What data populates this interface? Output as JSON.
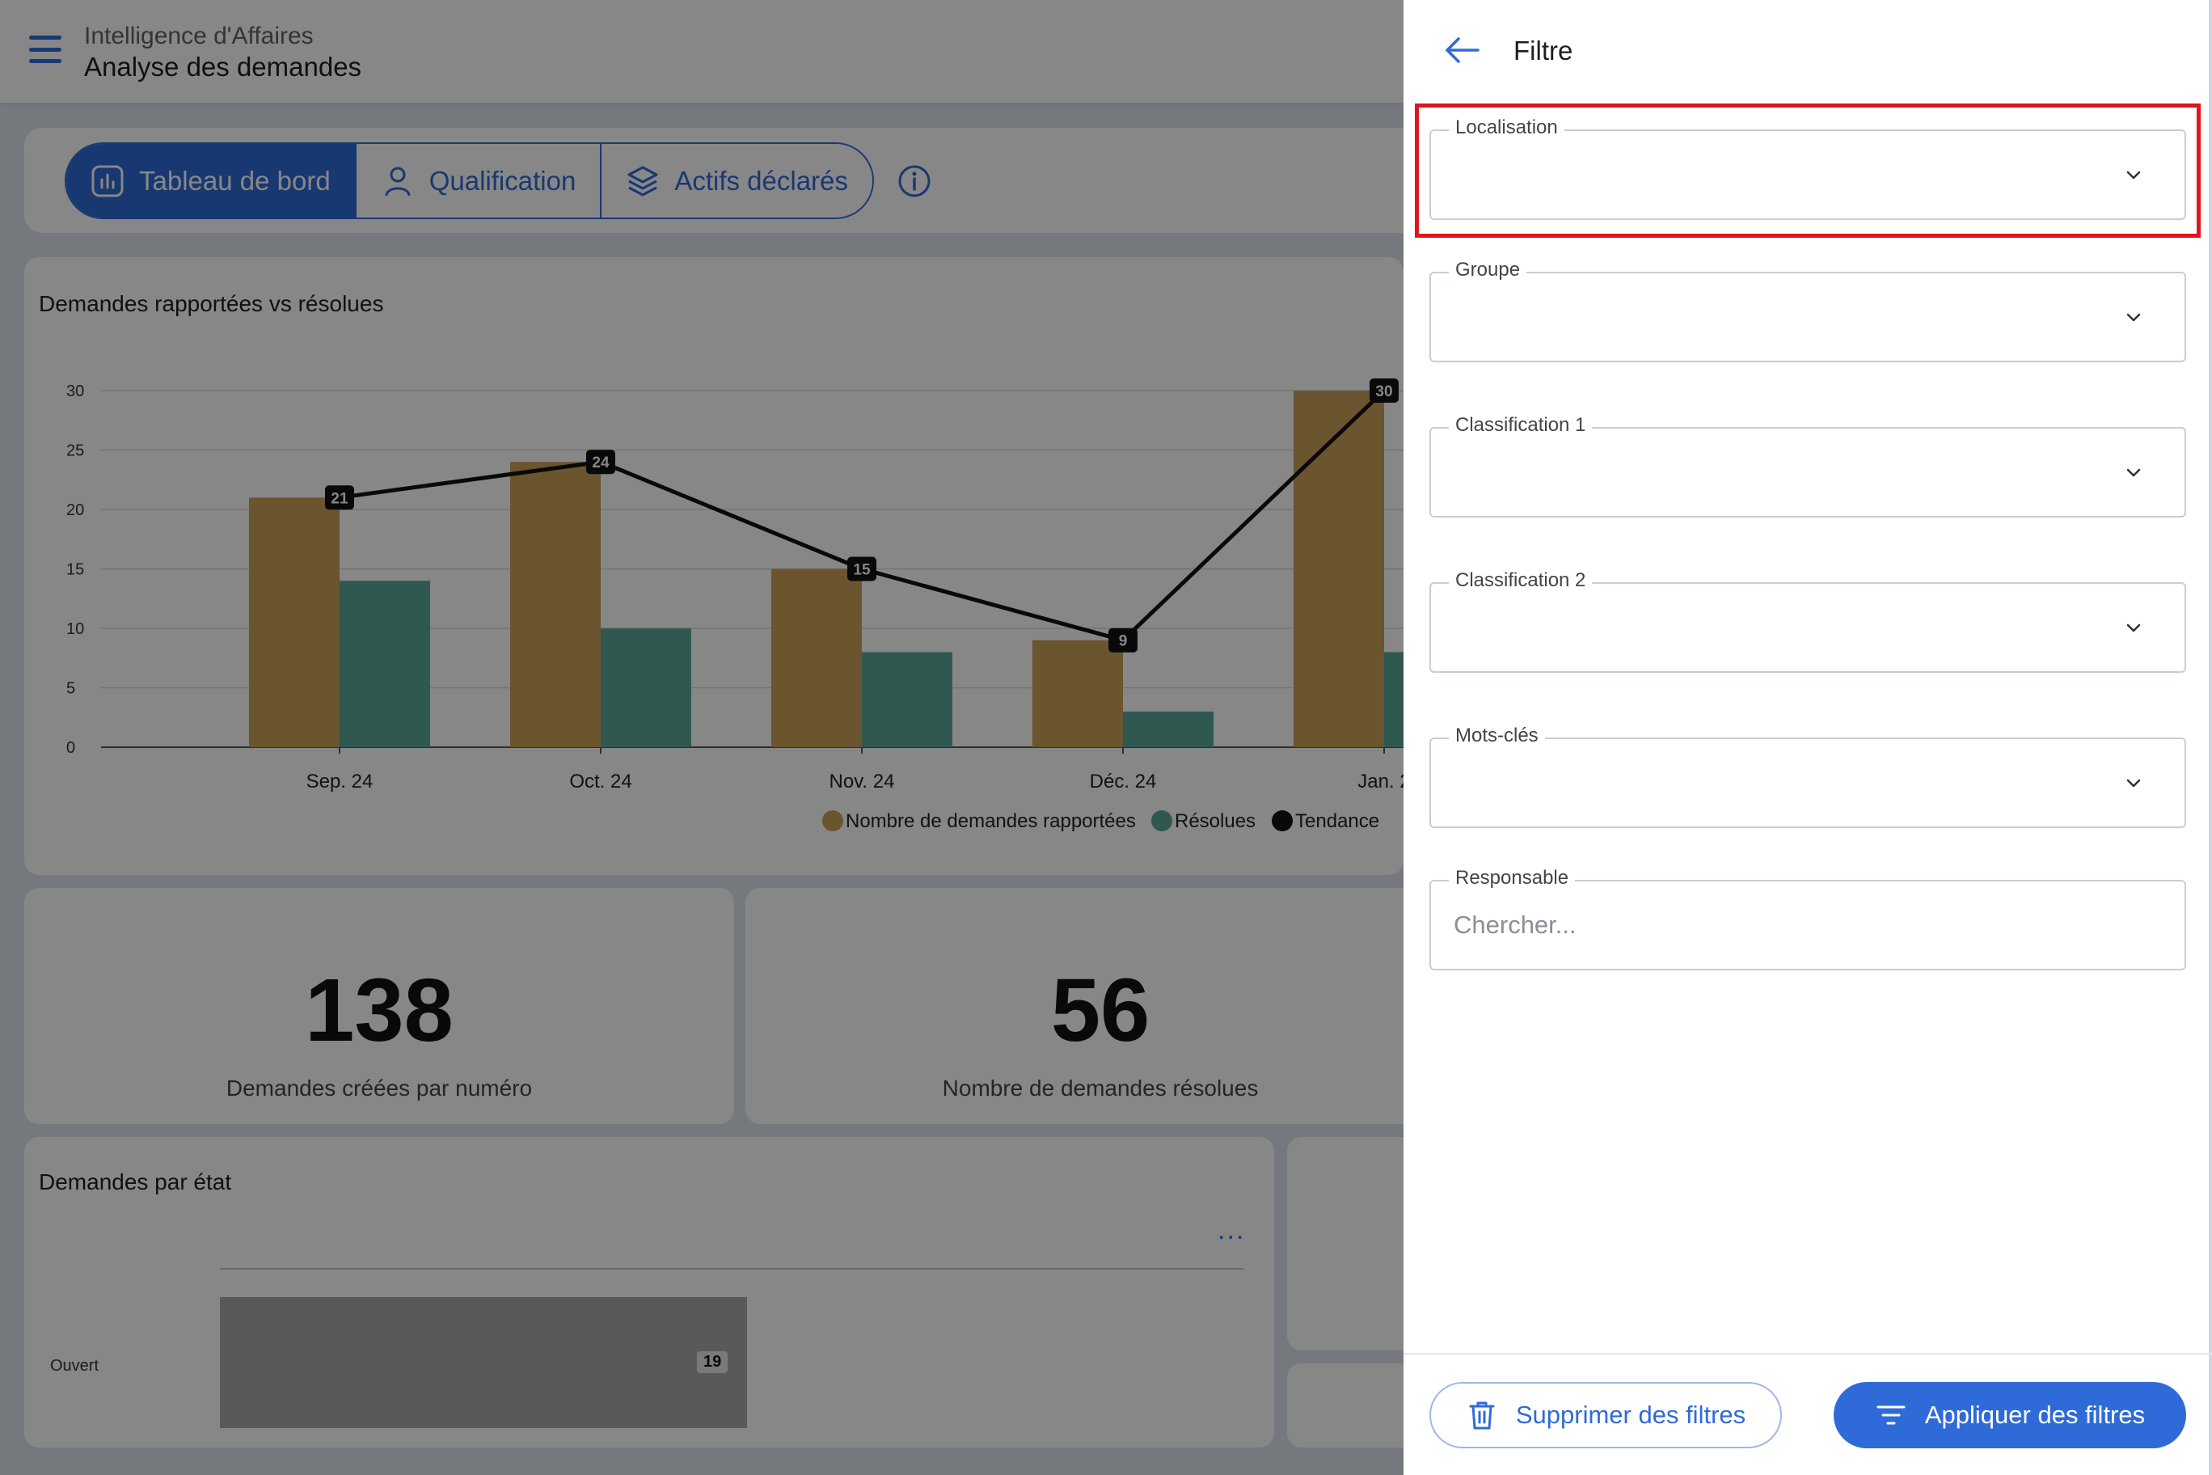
{
  "header": {
    "app_subtitle": "Intelligence d'Affaires",
    "app_title": "Analyse des demandes"
  },
  "tabs": [
    {
      "label": "Tableau de bord",
      "icon": "bar-chart-icon",
      "active": true
    },
    {
      "label": "Qualification",
      "icon": "person-icon",
      "active": false
    },
    {
      "label": "Actifs déclarés",
      "icon": "layers-icon",
      "active": false
    }
  ],
  "chart_section": {
    "title": "Demandes rapportées vs résolues"
  },
  "chart_data": {
    "type": "bar",
    "categories": [
      "Sep. 24",
      "Oct. 24",
      "Nov. 24",
      "Déc. 24",
      "Jan. 2"
    ],
    "series": [
      {
        "name": "Nombre de demandes rapportées",
        "type": "bar",
        "color": "#c9a159",
        "values": [
          21,
          24,
          15,
          9,
          30
        ]
      },
      {
        "name": "Résolues",
        "type": "bar",
        "color": "#5aa79a",
        "values": [
          14,
          10,
          8,
          3,
          8
        ]
      },
      {
        "name": "Tendance",
        "type": "line",
        "color": "#111111",
        "values": [
          21,
          24,
          15,
          9,
          30
        ]
      }
    ],
    "yticks": [
      "0",
      "5",
      "10",
      "15",
      "20",
      "25",
      "30"
    ],
    "ylim": [
      0,
      30
    ],
    "grid": true,
    "legend": "bottom"
  },
  "kpis": [
    {
      "value": "138",
      "label": "Demandes créées par numéro"
    },
    {
      "value": "56",
      "label": "Nombre de demandes résolues"
    }
  ],
  "status_section": {
    "title": "Demandes par état",
    "more_label": "...",
    "bar_label": "Ouvert",
    "bar_value": "19",
    "bar_fraction": 1.0
  },
  "filter_panel": {
    "title": "Filtre",
    "fields": {
      "localisation": "Localisation",
      "groupe": "Groupe",
      "classification1": "Classification 1",
      "classification2": "Classification 2",
      "mots_cles": "Mots-clés",
      "responsable": "Responsable",
      "responsable_placeholder": "Chercher..."
    },
    "clear_label": "Supprimer des filtres",
    "apply_label": "Appliquer des filtres"
  }
}
